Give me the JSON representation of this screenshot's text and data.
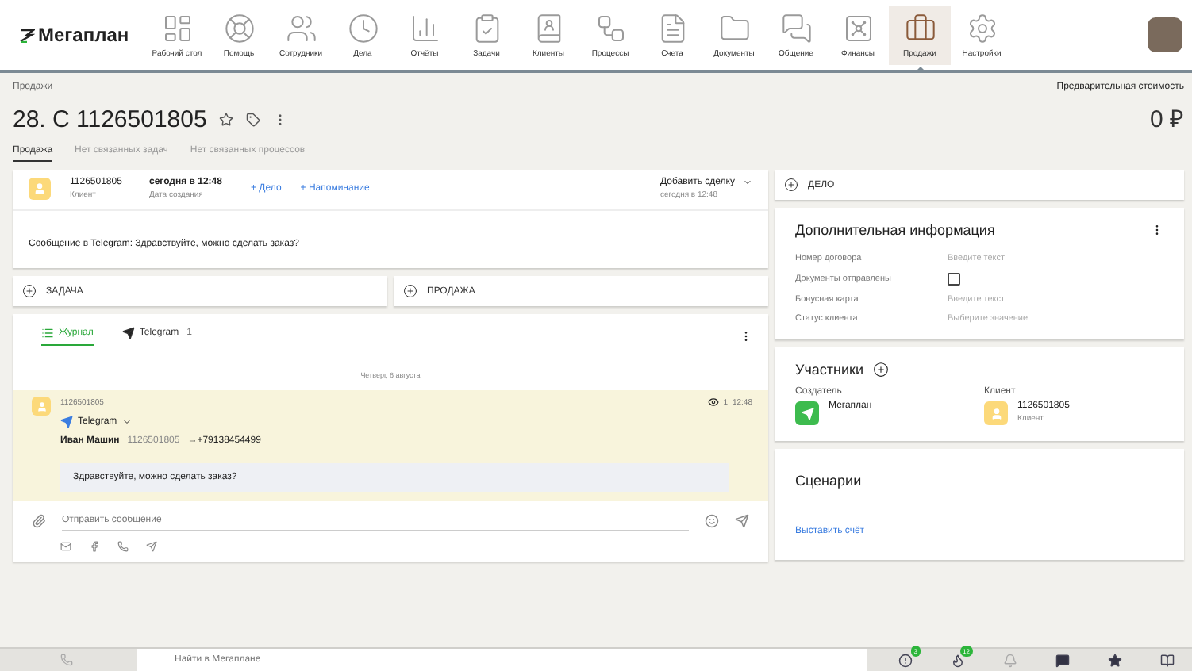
{
  "nav": {
    "logo": "Мегаплан",
    "items": [
      {
        "label": "Рабочий стол",
        "selected": false
      },
      {
        "label": "Помощь",
        "selected": false
      },
      {
        "label": "Сотрудники",
        "selected": false
      },
      {
        "label": "Дела",
        "selected": false
      },
      {
        "label": "Отчёты",
        "selected": false
      },
      {
        "label": "Задачи",
        "selected": false
      },
      {
        "label": "Клиенты",
        "selected": false
      },
      {
        "label": "Процессы",
        "selected": false
      },
      {
        "label": "Счета",
        "selected": false
      },
      {
        "label": "Документы",
        "selected": false
      },
      {
        "label": "Общение",
        "selected": false
      },
      {
        "label": "Финансы",
        "selected": false
      },
      {
        "label": "Продажи",
        "selected": true
      },
      {
        "label": "Настройки",
        "selected": false
      }
    ]
  },
  "header": {
    "breadcrumb": "Продажи",
    "title": "28. С 1126501805",
    "cost_label": "Предварительная стоимость",
    "cost": "0 ₽"
  },
  "tabs": [
    {
      "label": "Продажа",
      "selected": true
    },
    {
      "label": "Нет связанных задач",
      "selected": false
    },
    {
      "label": "Нет связанных процессов",
      "selected": false
    }
  ],
  "event": {
    "client": "1126501805",
    "client_role": "Клиент",
    "date": "сегодня в 12:48",
    "date_label": "Дата создания",
    "links": [
      "+ Дело",
      "+ Напоминание"
    ],
    "action": "Добавить сделку",
    "action_date": "сегодня в 12:48",
    "message": "Сообщение в Telegram: Здравствуйте, можно сделать заказ?"
  },
  "add_buttons": [
    "ЗАДАЧА",
    "ПРОДАЖА"
  ],
  "journal": {
    "tabs": [
      {
        "label": "Журнал",
        "selected": true
      },
      {
        "label": "Telegram",
        "count": "1",
        "selected": false
      }
    ],
    "date": "Четверг, 6 августа",
    "message": {
      "sender": "1126501805",
      "channel": "Telegram",
      "from": "Иван Машин",
      "from_id": "1126501805",
      "to": "→+79138454499",
      "views": "1",
      "time": "12:48",
      "text": "Здравствуйте, можно сделать заказ?"
    },
    "composer": {
      "placeholder": "Отправить сообщение"
    }
  },
  "side_add": "ДЕЛО",
  "info": {
    "title": "Дополнительная информация",
    "fields": [
      {
        "kind": "text",
        "label": "Номер договора",
        "placeholder": "Введите текст"
      },
      {
        "kind": "checkbox",
        "label": "Документы отправлены",
        "checked": false
      },
      {
        "kind": "text",
        "label": "Бонусная карта",
        "placeholder": "Введите текст"
      },
      {
        "kind": "select",
        "label": "Статус клиента",
        "placeholder": "Выберите значение"
      }
    ]
  },
  "participants": {
    "title": "Участники",
    "groups": [
      {
        "role": "Создатель",
        "kind": "company",
        "name": "Мегаплан"
      },
      {
        "role": "Клиент",
        "kind": "client",
        "name": "1126501805",
        "sub": "Клиент"
      }
    ]
  },
  "scenarios": {
    "title": "Сценарии",
    "link": "Выставить счёт"
  },
  "bottom": {
    "search": {
      "placeholder": "Найти в Мегаплане"
    },
    "badges": [
      "3",
      "12"
    ]
  }
}
